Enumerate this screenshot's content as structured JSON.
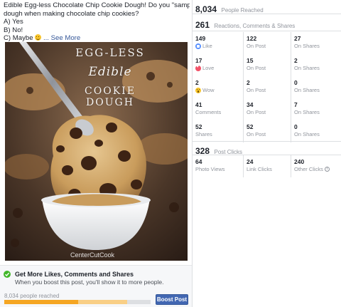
{
  "post": {
    "line1": "Edible Egg-less Chocolate Chip Cookie Dough! Do you \"sample\" the cookie",
    "line2": "dough when making chocolate chip cookies?",
    "option_a": "A) Yes",
    "option_b": "B) No!",
    "option_c": "C) Maybe",
    "see_more": "... See More",
    "photo": {
      "title_line1": "EGG-LESS",
      "title_line2": "Edible",
      "title_line3": "COOKIE DOUGH",
      "watermark": "CenterCutCook"
    }
  },
  "promo": {
    "title": "Get More Likes, Comments and Shares",
    "subtitle": "When you boost this post, you'll show it to more people.",
    "reach_label": "8,034 people reached",
    "reach_progress_fraction": 0.84,
    "boost_label": "Boost Post",
    "icon": "check-circle-icon"
  },
  "insights": {
    "people_reached": {
      "value": "8,034",
      "label": "People Reached"
    },
    "reactions": {
      "value": "261",
      "label": "Reactions, Comments & Shares"
    },
    "rows": [
      {
        "cells": [
          {
            "num": "149",
            "label": "Like",
            "icon": "like-icon"
          },
          {
            "num": "122",
            "label": "On Post"
          },
          {
            "num": "27",
            "label": "On Shares"
          }
        ]
      },
      {
        "cells": [
          {
            "num": "17",
            "label": "Love",
            "icon": "love-icon"
          },
          {
            "num": "15",
            "label": "On Post"
          },
          {
            "num": "2",
            "label": "On Shares"
          }
        ]
      },
      {
        "cells": [
          {
            "num": "2",
            "label": "Wow",
            "icon": "wow-icon"
          },
          {
            "num": "2",
            "label": "On Post"
          },
          {
            "num": "0",
            "label": "On Shares"
          }
        ]
      },
      {
        "cells": [
          {
            "num": "41",
            "label": "Comments"
          },
          {
            "num": "34",
            "label": "On Post"
          },
          {
            "num": "7",
            "label": "On Shares"
          }
        ]
      },
      {
        "cells": [
          {
            "num": "52",
            "label": "Shares"
          },
          {
            "num": "52",
            "label": "On Post"
          },
          {
            "num": "0",
            "label": "On Shares"
          }
        ]
      }
    ],
    "post_clicks": {
      "value": "328",
      "label": "Post Clicks"
    },
    "click_row": [
      {
        "num": "64",
        "label": "Photo Views"
      },
      {
        "num": "24",
        "label": "Link Clicks"
      },
      {
        "num": "240",
        "label": "Other Clicks",
        "icon": "info-icon"
      }
    ]
  },
  "colors": {
    "link": "#365899",
    "boost_button": "#4267b2",
    "progress": "#f5a623",
    "like": "#5890ff",
    "love": "#f25268",
    "wow": "#f7c42b",
    "check": "#42b72a"
  }
}
